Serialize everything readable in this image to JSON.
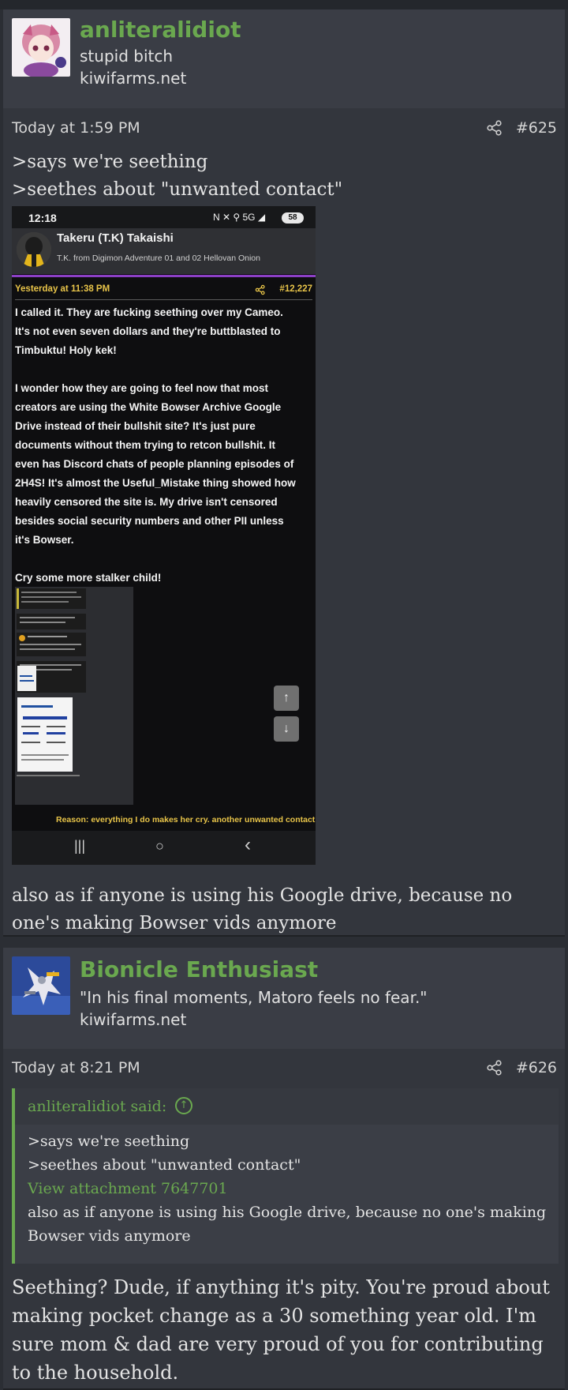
{
  "colors": {
    "accent": "#6aa84f",
    "background": "#2b2e34",
    "panel": "#33363d",
    "highlight": "#e8c449",
    "purple_bar": "#8b3fc4"
  },
  "posts": [
    {
      "username": "anliteralidiot",
      "user_title": "stupid bitch",
      "site": "kiwifarms.net",
      "time": "Today at 1:59 PM",
      "number": "#625",
      "share_icon": "share-icon",
      "lines": [
        ">says we're seething",
        ">seethes about \"unwanted contact\""
      ],
      "after_text": "also as if anyone is using his Google drive, because no one's making Bowser vids anymore",
      "attachment": {
        "clock": "12:18",
        "status_icons": "N ✕ ⚲ 5G ◢",
        "battery": "58",
        "inner_username": "Takeru (T.K) Takaishi",
        "inner_subtitle": "T.K. from Digimon Adventure 01 and 02   Hellovan Onion",
        "inner_time": "Yesterday at 11:38 PM",
        "inner_number": "#12,227",
        "inner_text": "I called it. They are fucking seething over my Cameo.\nIt's not even seven dollars and they're buttblasted to\nTimbuktu! Holy kek!\n\nI wonder how they are going to feel now that most\ncreators are using the White Bowser Archive Google\nDrive instead of their bullshit site? It's just pure\ndocuments without them trying to retcon bullshit. It\neven has Discord chats of people planning episodes of\n2H4S! It's almost the Useful_Mistake thing showed how\nheavily censored the site is. My drive isn't censored\nbesides social security numbers and other PII unless\nit's Bowser.\n\nCry some more stalker child!",
        "reason": "Reason: everything I do makes her cry. another unwanted contact",
        "nav_recent": "|||",
        "nav_home": "○",
        "nav_back": "‹",
        "scroll_up": "↑",
        "scroll_down": "↓"
      }
    },
    {
      "username": "Bionicle Enthusiast",
      "user_title": "\"In his final moments, Matoro feels no fear.\"",
      "site": "kiwifarms.net",
      "time": "Today at 8:21 PM",
      "number": "#626",
      "share_icon": "share-icon",
      "quote": {
        "author": "anliteralidiot said:",
        "line1": ">says we're seething",
        "line2": ">seethes about \"unwanted contact\"",
        "attachment_link": "View attachment 7647701",
        "line3": "also as if anyone is using his Google drive, because no one's making Bowser vids anymore"
      },
      "reply": "Seething? Dude, if anything it's pity. You're proud about making pocket change as a 30 something year old. I'm sure mom & dad are very proud of you for contributing to the household."
    }
  ]
}
